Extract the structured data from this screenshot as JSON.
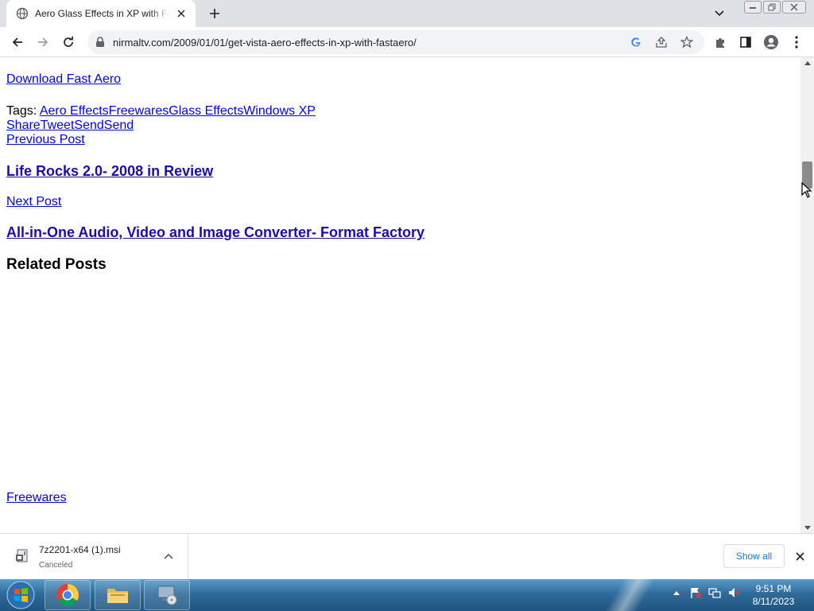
{
  "browser": {
    "tab_title": "Aero Glass Effects in XP with Fast",
    "url": "nirmaltv.com/2009/01/01/get-vista-aero-effects-in-xp-with-fastaero/"
  },
  "page": {
    "download_link": "Download Fast Aero",
    "tags_label": "Tags:",
    "tags": [
      "Aero Effects",
      "Freewares",
      "Glass Effects",
      "Windows XP"
    ],
    "share_links": [
      "Share",
      "Tweet",
      "Send",
      "Send"
    ],
    "previous_label": "Previous Post",
    "previous_title": "Life Rocks 2.0- 2008 in Review",
    "next_label": "Next Post",
    "next_title": "All-in-One Audio, Video and Image Converter- Format Factory",
    "related_heading": "Related Posts",
    "category_link": "Freewares"
  },
  "download_bar": {
    "filename": "7z2201-x64 (1).msi",
    "status": "Canceled",
    "show_all": "Show all"
  },
  "taskbar": {
    "time": "9:51 PM",
    "date": "8/11/2023"
  },
  "colors": {
    "link": "#0000ee",
    "heading_link": "#1a0dab",
    "accent": "#1a73e8"
  }
}
